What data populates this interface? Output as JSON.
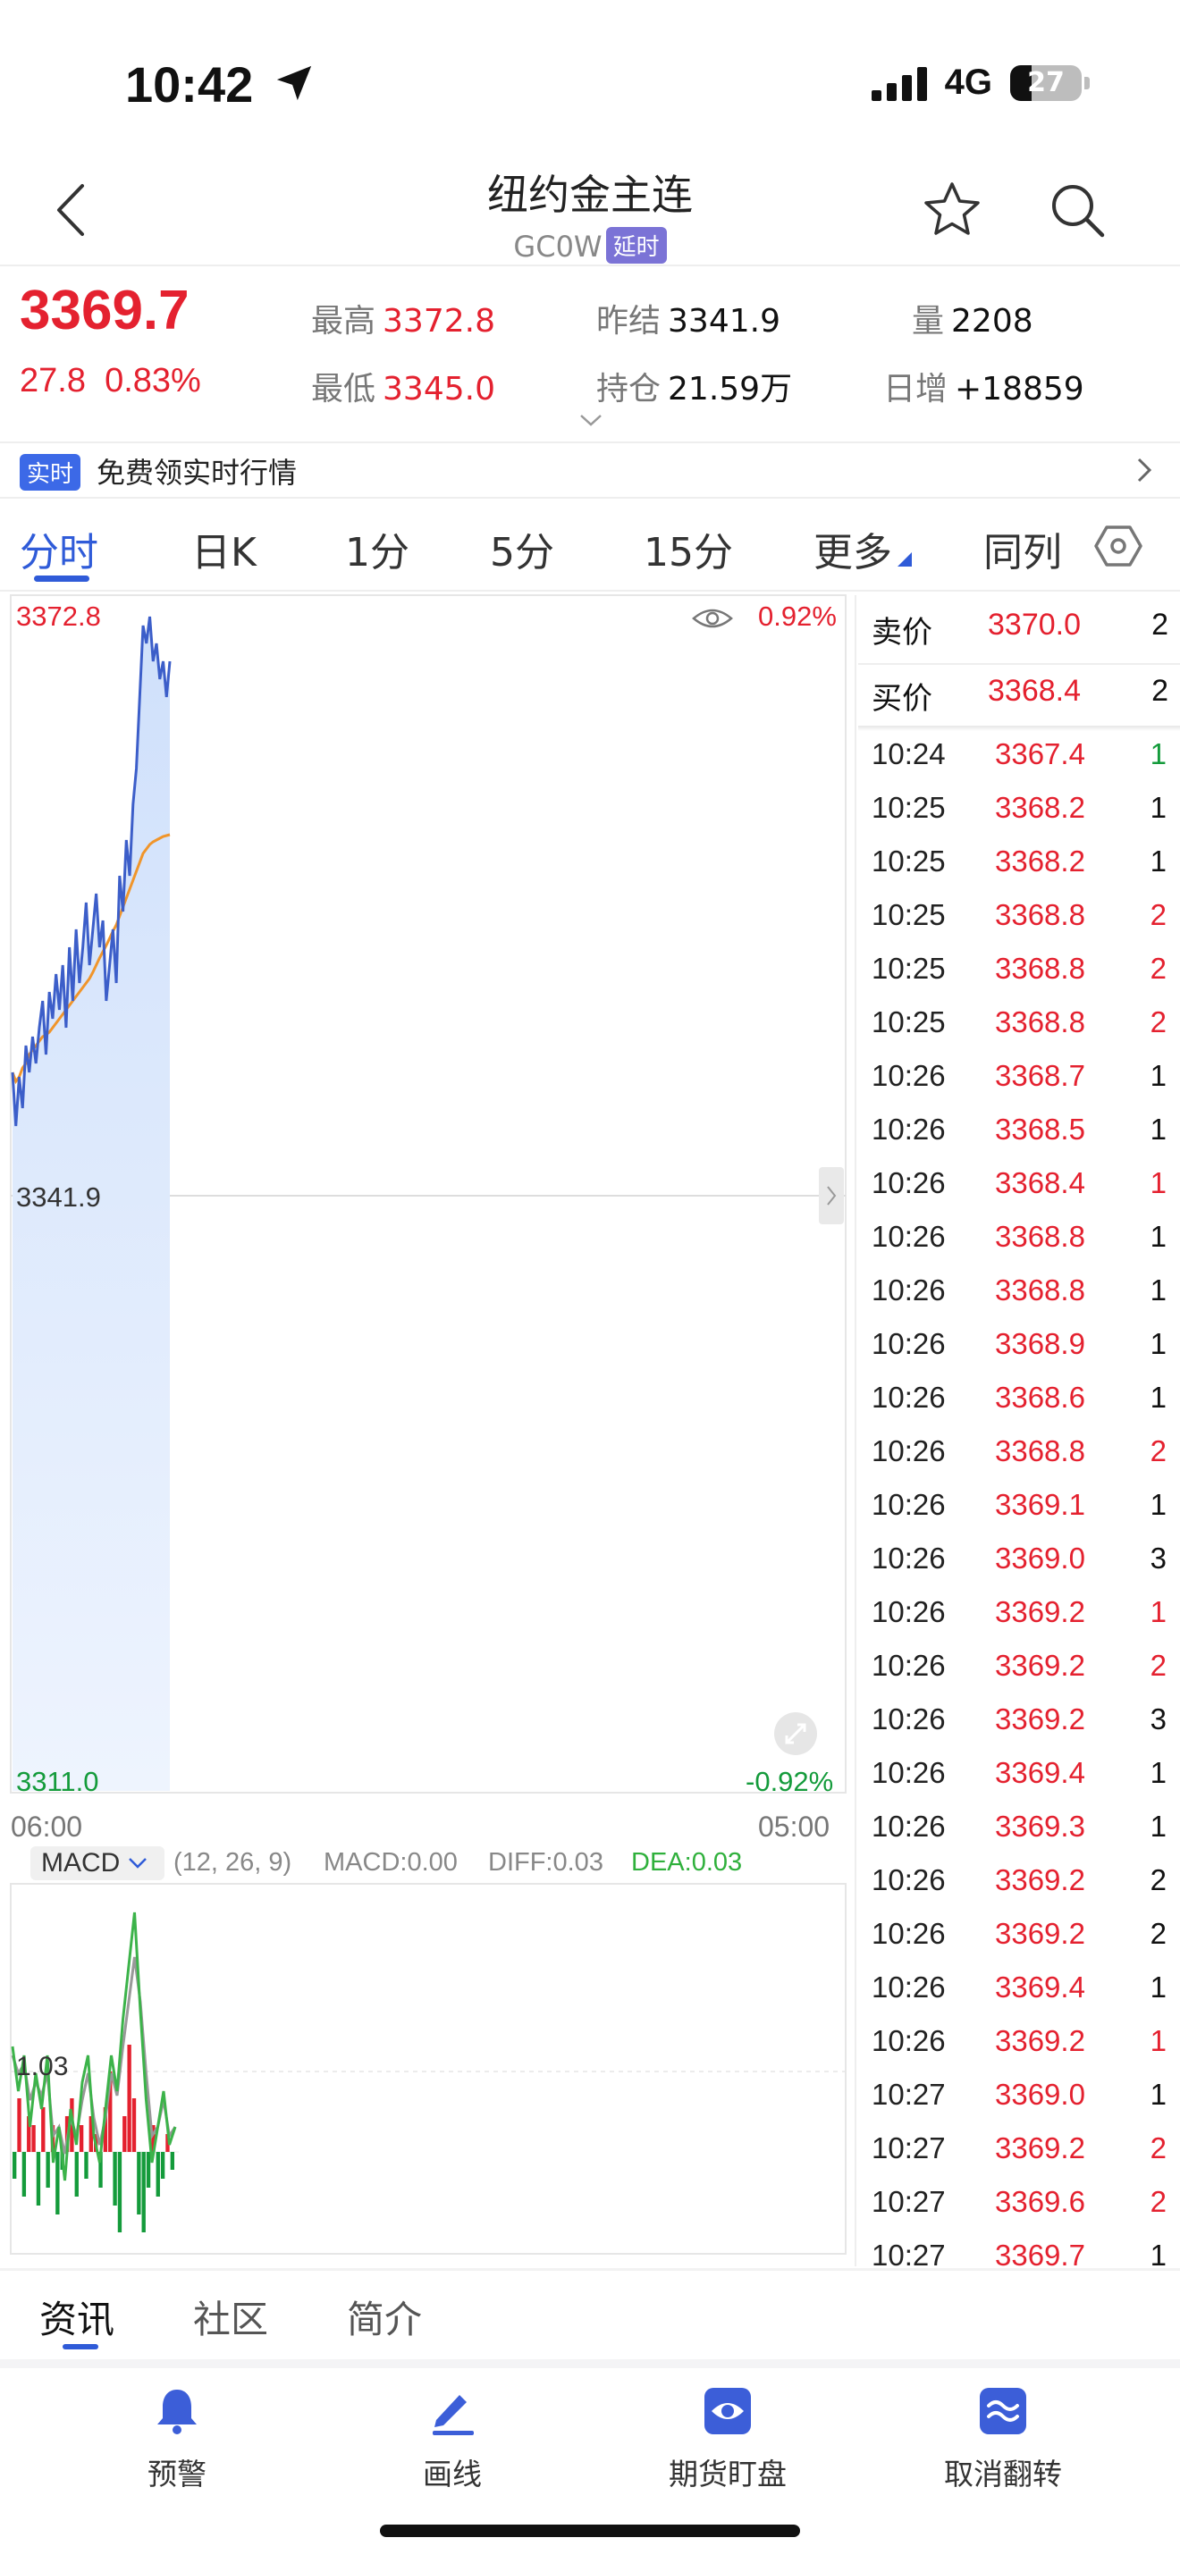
{
  "status_bar": {
    "time": "10:42",
    "network": "4G",
    "battery": "27"
  },
  "header": {
    "title": "纽约金主连",
    "code": "GC0W",
    "delay_tag": "延时"
  },
  "quote": {
    "price": "3369.7",
    "change": "27.8",
    "change_pct": "0.83%",
    "high_label": "最高",
    "high": "3372.8",
    "low_label": "最低",
    "low": "3345.0",
    "prev_close_label": "昨结",
    "prev_close": "3341.9",
    "open_interest_label": "持仓",
    "open_interest": "21.59万",
    "volume_label": "量",
    "volume": "2208",
    "daily_increase_label": "日增",
    "daily_increase": "+18859"
  },
  "banner": {
    "tag": "实时",
    "text": "免费领实时行情"
  },
  "tabs": [
    "分时",
    "日K",
    "1分",
    "5分",
    "15分",
    "更多",
    "同列"
  ],
  "chart": {
    "y_top_label": "3372.8",
    "y_mid_label": "3341.9",
    "y_bottom_label": "3311.0",
    "pct_top": "0.92%",
    "pct_bottom": "-0.92%",
    "x_start": "06:00",
    "x_end": "05:00"
  },
  "macd": {
    "selector": "MACD",
    "params": "(12, 26, 9)",
    "macd_label": "MACD:",
    "macd_value": "0.00",
    "diff_label": "DIFF:",
    "diff_value": "0.03",
    "dea_label": "DEA:",
    "dea_value": "0.03",
    "level_label": "1.03"
  },
  "order_book": {
    "ask_label": "卖价",
    "ask_price": "3370.0",
    "ask_qty": "2",
    "bid_label": "买价",
    "bid_price": "3368.4",
    "bid_qty": "2"
  },
  "trades": [
    {
      "time": "10:24",
      "price": "3367.4",
      "qty": "1",
      "color": "green"
    },
    {
      "time": "10:25",
      "price": "3368.2",
      "qty": "1",
      "color": "black"
    },
    {
      "time": "10:25",
      "price": "3368.2",
      "qty": "1",
      "color": "black"
    },
    {
      "time": "10:25",
      "price": "3368.8",
      "qty": "2",
      "color": "red"
    },
    {
      "time": "10:25",
      "price": "3368.8",
      "qty": "2",
      "color": "red"
    },
    {
      "time": "10:25",
      "price": "3368.8",
      "qty": "2",
      "color": "red"
    },
    {
      "time": "10:26",
      "price": "3368.7",
      "qty": "1",
      "color": "black"
    },
    {
      "time": "10:26",
      "price": "3368.5",
      "qty": "1",
      "color": "black"
    },
    {
      "time": "10:26",
      "price": "3368.4",
      "qty": "1",
      "color": "red"
    },
    {
      "time": "10:26",
      "price": "3368.8",
      "qty": "1",
      "color": "black"
    },
    {
      "time": "10:26",
      "price": "3368.8",
      "qty": "1",
      "color": "black"
    },
    {
      "time": "10:26",
      "price": "3368.9",
      "qty": "1",
      "color": "black"
    },
    {
      "time": "10:26",
      "price": "3368.6",
      "qty": "1",
      "color": "black"
    },
    {
      "time": "10:26",
      "price": "3368.8",
      "qty": "2",
      "color": "red"
    },
    {
      "time": "10:26",
      "price": "3369.1",
      "qty": "1",
      "color": "black"
    },
    {
      "time": "10:26",
      "price": "3369.0",
      "qty": "3",
      "color": "black"
    },
    {
      "time": "10:26",
      "price": "3369.2",
      "qty": "1",
      "color": "red"
    },
    {
      "time": "10:26",
      "price": "3369.2",
      "qty": "2",
      "color": "red"
    },
    {
      "time": "10:26",
      "price": "3369.2",
      "qty": "3",
      "color": "black"
    },
    {
      "time": "10:26",
      "price": "3369.4",
      "qty": "1",
      "color": "black"
    },
    {
      "time": "10:26",
      "price": "3369.3",
      "qty": "1",
      "color": "black"
    },
    {
      "time": "10:26",
      "price": "3369.2",
      "qty": "2",
      "color": "black"
    },
    {
      "time": "10:26",
      "price": "3369.2",
      "qty": "2",
      "color": "black"
    },
    {
      "time": "10:26",
      "price": "3369.4",
      "qty": "1",
      "color": "black"
    },
    {
      "time": "10:26",
      "price": "3369.2",
      "qty": "1",
      "color": "red"
    },
    {
      "time": "10:27",
      "price": "3369.0",
      "qty": "1",
      "color": "black"
    },
    {
      "time": "10:27",
      "price": "3369.2",
      "qty": "2",
      "color": "red"
    },
    {
      "time": "10:27",
      "price": "3369.6",
      "qty": "2",
      "color": "red"
    },
    {
      "time": "10:27",
      "price": "3369.7",
      "qty": "1",
      "color": "black"
    }
  ],
  "bottom_tabs": [
    "资讯",
    "社区",
    "简介"
  ],
  "bottom_nav": [
    {
      "label": "预警",
      "icon": "bell-icon"
    },
    {
      "label": "画线",
      "icon": "pen-line-icon"
    },
    {
      "label": "期货盯盘",
      "icon": "eye-icon"
    },
    {
      "label": "取消翻转",
      "icon": "flip-icon"
    }
  ],
  "colors": {
    "up": "#e4212f",
    "down": "#149b3b",
    "accent": "#2f5bd8",
    "price_line": "#3c5ec9",
    "avg_line": "#f0952b"
  }
}
